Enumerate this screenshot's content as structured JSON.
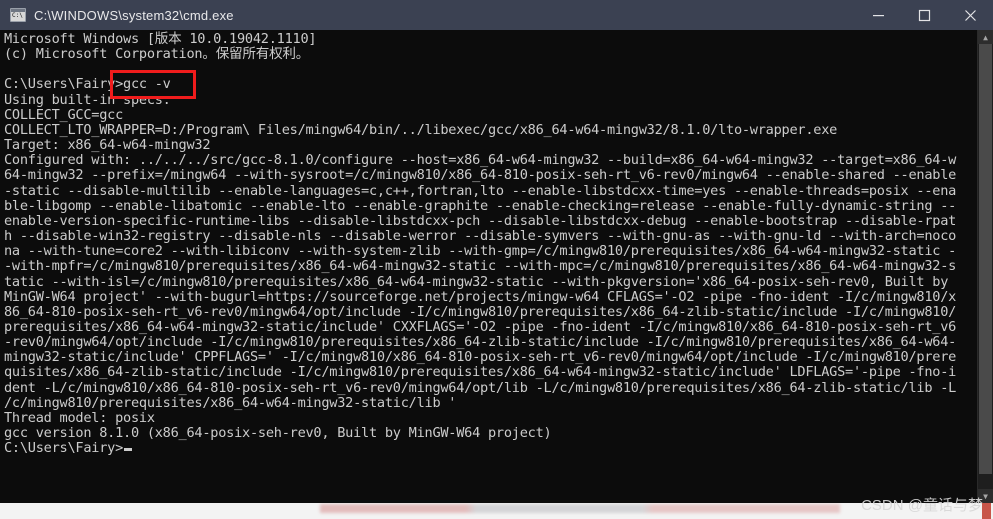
{
  "window": {
    "title": "C:\\WINDOWS\\system32\\cmd.exe",
    "icon": "cmd-console-icon",
    "controls": {
      "minimize": "minimize-button",
      "maximize": "maximize-button",
      "close": "close-button"
    }
  },
  "colors": {
    "titlebar_bg": "#3b4152",
    "console_bg": "#0c0c0c",
    "console_fg": "#cccccc",
    "annotation": "#f01c1c",
    "scrollbar_thumb": "#4a4a4a"
  },
  "console": {
    "text": "Microsoft Windows [版本 10.0.19042.1110]\n(c) Microsoft Corporation。保留所有权利。\n\nC:\\Users\\Fairy>gcc -v\nUsing built-in specs.\nCOLLECT_GCC=gcc\nCOLLECT_LTO_WRAPPER=D:/Program\\ Files/mingw64/bin/../libexec/gcc/x86_64-w64-mingw32/8.1.0/lto-wrapper.exe\nTarget: x86_64-w64-mingw32\nConfigured with: ../../../src/gcc-8.1.0/configure --host=x86_64-w64-mingw32 --build=x86_64-w64-mingw32 --target=x86_64-w\n64-mingw32 --prefix=/mingw64 --with-sysroot=/c/mingw810/x86_64-810-posix-seh-rt_v6-rev0/mingw64 --enable-shared --enable\n-static --disable-multilib --enable-languages=c,c++,fortran,lto --enable-libstdcxx-time=yes --enable-threads=posix --ena\nble-libgomp --enable-libatomic --enable-lto --enable-graphite --enable-checking=release --enable-fully-dynamic-string --\nenable-version-specific-runtime-libs --disable-libstdcxx-pch --disable-libstdcxx-debug --enable-bootstrap --disable-rpat\nh --disable-win32-registry --disable-nls --disable-werror --disable-symvers --with-gnu-as --with-gnu-ld --with-arch=noco\nna --with-tune=core2 --with-libiconv --with-system-zlib --with-gmp=/c/mingw810/prerequisites/x86_64-w64-mingw32-static -\n-with-mpfr=/c/mingw810/prerequisites/x86_64-w64-mingw32-static --with-mpc=/c/mingw810/prerequisites/x86_64-w64-mingw32-s\ntatic --with-isl=/c/mingw810/prerequisites/x86_64-w64-mingw32-static --with-pkgversion='x86_64-posix-seh-rev0, Built by\nMinGW-W64 project' --with-bugurl=https://sourceforge.net/projects/mingw-w64 CFLAGS='-O2 -pipe -fno-ident -I/c/mingw810/x\n86_64-810-posix-seh-rt_v6-rev0/mingw64/opt/include -I/c/mingw810/prerequisites/x86_64-zlib-static/include -I/c/mingw810/\nprerequisites/x86_64-w64-mingw32-static/include' CXXFLAGS='-O2 -pipe -fno-ident -I/c/mingw810/x86_64-810-posix-seh-rt_v6\n-rev0/mingw64/opt/include -I/c/mingw810/prerequisites/x86_64-zlib-static/include -I/c/mingw810/prerequisites/x86_64-w64-\nmingw32-static/include' CPPFLAGS=' -I/c/mingw810/x86_64-810-posix-seh-rt_v6-rev0/mingw64/opt/include -I/c/mingw810/prere\nquisites/x86_64-zlib-static/include -I/c/mingw810/prerequisites/x86_64-w64-mingw32-static/include' LDFLAGS='-pipe -fno-i\ndent -L/c/mingw810/x86_64-810-posix-seh-rt_v6-rev0/mingw64/opt/lib -L/c/mingw810/prerequisites/x86_64-zlib-static/lib -L\n/c/mingw810/prerequisites/x86_64-w64-mingw32-static/lib '\nThread model: posix\ngcc version 8.1.0 (x86_64-posix-seh-rev0, Built by MinGW-W64 project)\n",
    "prompt": "C:\\Users\\Fairy>"
  },
  "annotation": {
    "label": "gcc -v",
    "note": "red-rectangle-highlight"
  },
  "scrollbar": {
    "up_arrow": "▲",
    "down_arrow": "▼"
  },
  "watermark": {
    "text": "CSDN @童话与梦"
  }
}
